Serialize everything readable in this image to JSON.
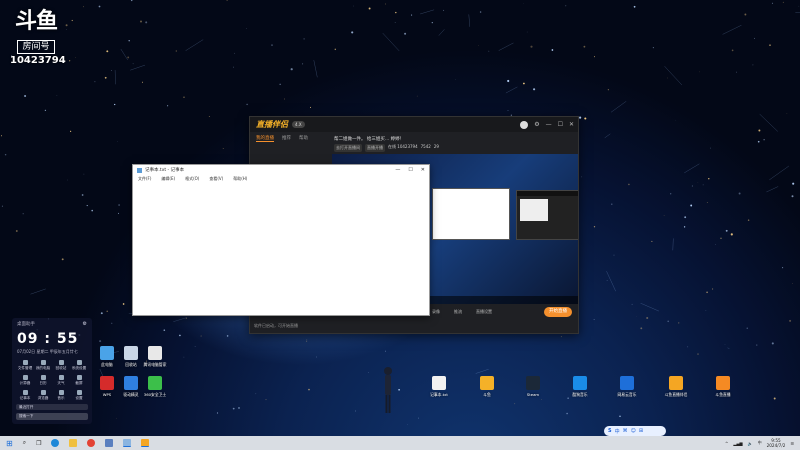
{
  "watermark": {
    "logo": "斗鱼",
    "room_label": "房间号",
    "room_number": "10423794"
  },
  "live_app": {
    "logo": "直播伴侣",
    "version": "4.X",
    "tabs": [
      "我的直播",
      "推荐",
      "帮助"
    ],
    "stream_title": "帮二姐做一件。 给三姐买... 婷婷！",
    "tags": [
      "去打开直播间",
      "直播开播",
      "在线 10423794",
      "7542",
      "29"
    ],
    "controls": [
      "录像",
      "推流",
      "直播设置"
    ],
    "start_button": "开始直播",
    "status": "软件已启动，可开始直播"
  },
  "notepad": {
    "title": "记事本.txt - 记事本",
    "menu": [
      "文件(F)",
      "编辑(E)",
      "格式(O)",
      "查看(V)",
      "帮助(H)"
    ]
  },
  "widget": {
    "title": "桌面助手",
    "time": "09 : 55",
    "date": "07月02日  星期二  甲辰年五月廿七",
    "items": [
      "文件管理",
      "我的电脑",
      "回收站",
      "系统设置",
      "计算器",
      "日历",
      "天气",
      "截屏",
      "记事本",
      "浏览器",
      "音乐",
      "设置"
    ],
    "recent": "最近打开",
    "search_placeholder": "搜索一下"
  },
  "desktop_icons": [
    {
      "label": "此电脑",
      "color": "#4aa3e8"
    },
    {
      "label": "回收站",
      "color": "#c9d6e6"
    },
    {
      "label": "腾讯电脑管家",
      "color": "#e8e8e8"
    },
    {
      "label": "WPS",
      "color": "#d52b2b"
    },
    {
      "label": "驱动精灵",
      "color": "#2f7fe0"
    },
    {
      "label": "360安全卫士",
      "color": "#3cbf4a"
    },
    {
      "label": "记事本.txt",
      "color": "#f2f2f2"
    },
    {
      "label": "斗鱼",
      "color": "#f5b128"
    },
    {
      "label": "Steam",
      "color": "#1b2838"
    },
    {
      "label": "酷狗音乐",
      "color": "#1a8ce8"
    },
    {
      "label": "网易云音乐",
      "color": "#1e6fd9"
    },
    {
      "label": "斗鱼直播伴侣",
      "color": "#f5a623"
    },
    {
      "label": "斗鱼直播",
      "color": "#f58a23"
    }
  ],
  "ime": {
    "items": [
      "S",
      "中",
      "⌘",
      "☺",
      "⊞"
    ]
  },
  "taskbar": {
    "clock_time": "9:55",
    "clock_date": "2024/7/2",
    "language": "中"
  }
}
